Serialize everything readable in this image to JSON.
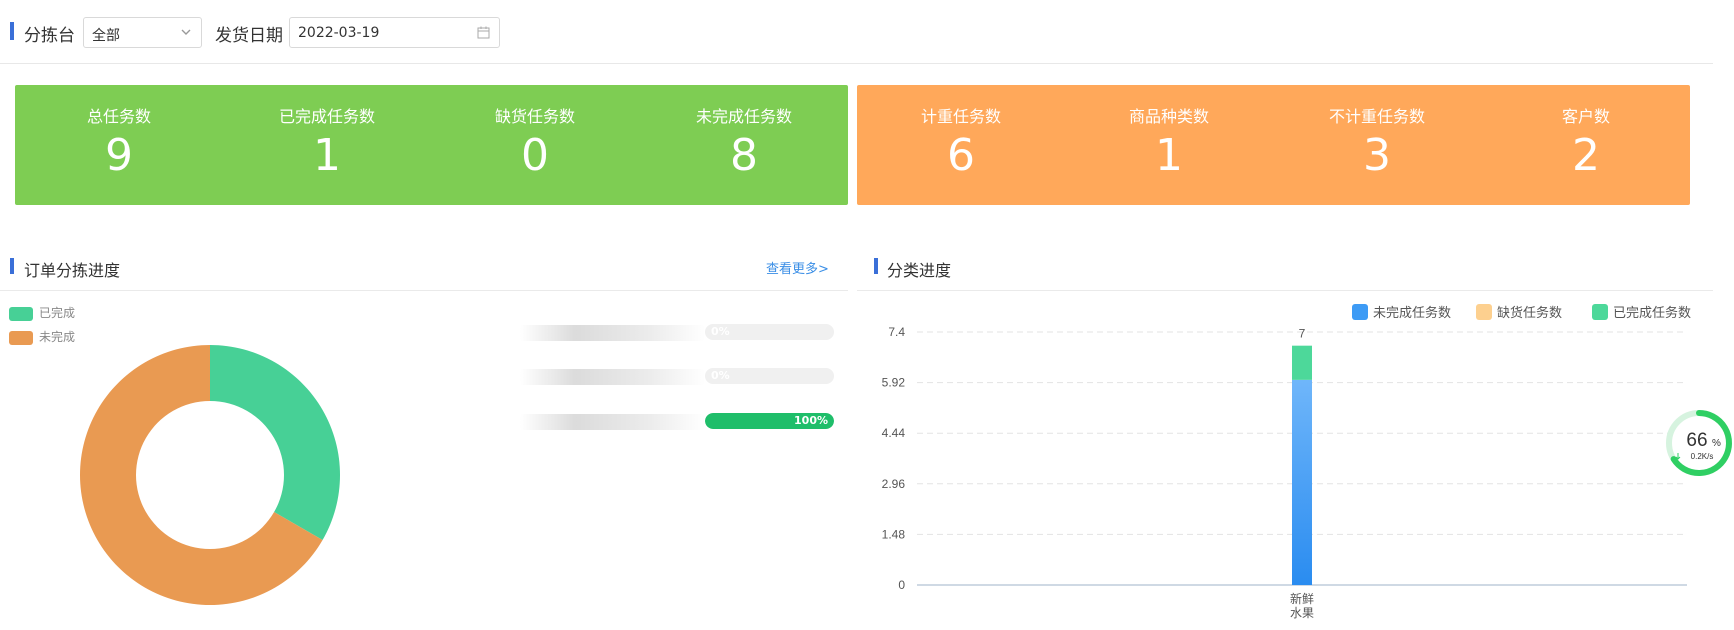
{
  "filters": {
    "station_label": "分拣台",
    "station_value": "全部",
    "date_label": "发货日期",
    "date_value": "2022-03-19"
  },
  "stats_green": [
    {
      "label": "总任务数",
      "value": "9"
    },
    {
      "label": "已完成任务数",
      "value": "1"
    },
    {
      "label": "缺货任务数",
      "value": "0"
    },
    {
      "label": "未完成任务数",
      "value": "8"
    }
  ],
  "stats_orange": [
    {
      "label": "计重任务数",
      "value": "6"
    },
    {
      "label": "商品种类数",
      "value": "1"
    },
    {
      "label": "不计重任务数",
      "value": "3"
    },
    {
      "label": "客户数",
      "value": "2"
    }
  ],
  "order_section": {
    "title": "订单分拣进度",
    "more_link": "查看更多>",
    "legend": [
      {
        "label": "已完成",
        "color": "#47d096"
      },
      {
        "label": "未完成",
        "color": "#e99a52"
      }
    ],
    "donut": {
      "completed": 1,
      "incomplete": 2
    },
    "progress": [
      {
        "pct_text": "0%",
        "value": 0
      },
      {
        "pct_text": "0%",
        "value": 0
      },
      {
        "pct_text": "100%",
        "value": 100
      }
    ]
  },
  "category_section": {
    "title": "分类进度"
  },
  "colors": {
    "green_panel": "#7ecd53",
    "orange_panel": "#ffa85a",
    "incomplete_series": "#3d9bf5",
    "shortage_series": "#fdd08f",
    "completed_series": "#4dd89a"
  },
  "chart_data": {
    "type": "bar",
    "stacked": true,
    "categories": [
      "新鲜\n水果"
    ],
    "series": [
      {
        "name": "未完成任务数",
        "values": [
          6
        ]
      },
      {
        "name": "缺货任务数",
        "values": [
          0
        ]
      },
      {
        "name": "已完成任务数",
        "values": [
          1
        ]
      }
    ],
    "total_labels": [
      "7"
    ],
    "ylim": [
      0,
      7.4
    ],
    "yticks": [
      "0",
      "1.48",
      "2.96",
      "4.44",
      "5.92",
      "7.4"
    ],
    "grid": true,
    "legend_position": "top-right"
  },
  "network_widget": {
    "percent": "66",
    "percent_unit": "%",
    "speed": "0.2K/s",
    "level": 0.66
  }
}
